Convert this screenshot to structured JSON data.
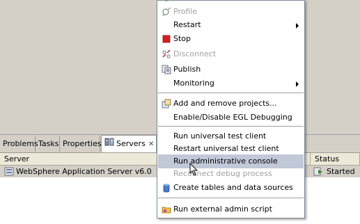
{
  "context_menu": {
    "items": [
      {
        "label": "Profile",
        "enabled": false,
        "icon": "profile-icon"
      },
      {
        "label": "Restart",
        "enabled": true,
        "submenu": true
      },
      {
        "label": "Stop",
        "enabled": true,
        "icon": "stop-icon"
      },
      {
        "label": "Disconnect",
        "enabled": false,
        "icon": "disconnect-icon"
      },
      {
        "label": "Publish",
        "enabled": true,
        "icon": "publish-icon"
      },
      {
        "label": "Monitoring",
        "enabled": true,
        "submenu": true
      },
      {
        "label": "Add and remove projects...",
        "enabled": true,
        "icon": "add-remove-projects-icon"
      },
      {
        "label": "Enable/Disable EGL Debugging",
        "enabled": true
      },
      {
        "label": "Run universal test client",
        "enabled": true
      },
      {
        "label": "Restart universal test client",
        "enabled": true
      },
      {
        "label": "Run administrative console",
        "enabled": true,
        "highlighted": true
      },
      {
        "label": "Reconnect debug process",
        "enabled": false
      },
      {
        "label": "Create tables and data sources",
        "enabled": true,
        "icon": "database-icon"
      },
      {
        "label": "Run external admin script",
        "enabled": true,
        "icon": "folder-script-icon"
      }
    ]
  },
  "view_tabs": [
    {
      "label": "Problems",
      "active": false
    },
    {
      "label": "Tasks",
      "active": false
    },
    {
      "label": "Properties",
      "active": false
    },
    {
      "label": "Servers",
      "active": true,
      "closable": true
    }
  ],
  "servers_table": {
    "columns": [
      "Server",
      "Status"
    ],
    "rows": [
      {
        "server": "WebSphere Application Server v6.0",
        "status": "Started"
      }
    ]
  },
  "colors": {
    "menu_highlight": "#c1c8d8",
    "disabled_text": "#a0a0a0",
    "panel_bg": "#d4d0c8"
  }
}
